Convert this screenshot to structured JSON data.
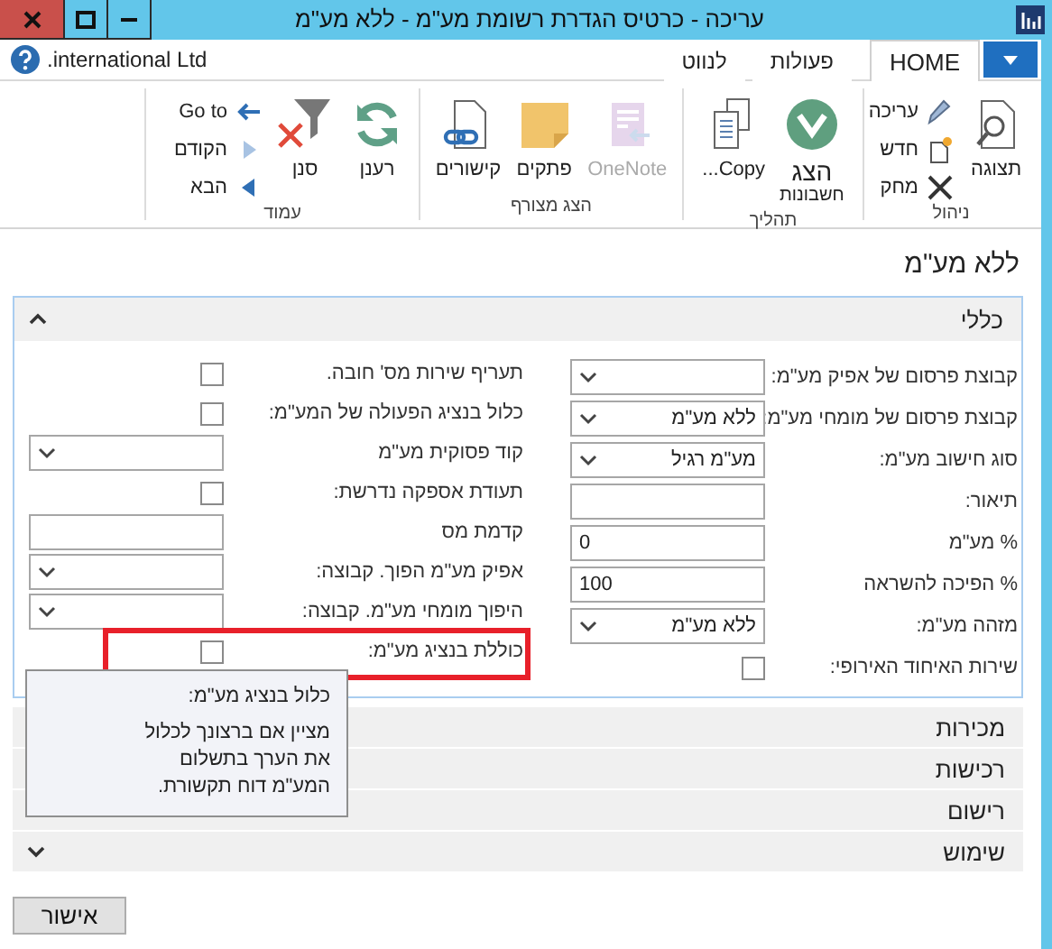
{
  "window": {
    "title": "עריכה - כרטיס הגדרת רשומת מע\"מ - ללא מע\"מ"
  },
  "tabs": [
    {
      "label": "HOME",
      "selected": true
    },
    {
      "label": "פעולות",
      "selected": false
    },
    {
      "label": "לנווט",
      "selected": false
    }
  ],
  "company": ".international Ltd",
  "ribbon": [
    {
      "label": "ניהול",
      "buttons": [
        {
          "kind": "large",
          "label": "תצוגה",
          "disabled": false
        },
        {
          "kind": "small",
          "label": "עריכה",
          "disabled": false
        },
        {
          "kind": "small",
          "label": "חדש",
          "disabled": false
        },
        {
          "kind": "small",
          "label": "מחק",
          "disabled": false
        }
      ]
    },
    {
      "label": "תהליך",
      "buttons": [
        {
          "kind": "large",
          "label": "הצג",
          "sublabel": "חשבונות",
          "disabled": false
        },
        {
          "kind": "large",
          "label": "Copy...",
          "disabled": false
        }
      ]
    },
    {
      "label": "הצג מצורף",
      "buttons": [
        {
          "kind": "large",
          "label": "OneNote",
          "disabled": true
        },
        {
          "kind": "large",
          "label": "פתקים",
          "disabled": false
        },
        {
          "kind": "large",
          "label": "קישורים",
          "disabled": false
        }
      ]
    },
    {
      "label": "עמוד",
      "buttons": [
        {
          "kind": "large",
          "label": "רענן",
          "disabled": false
        },
        {
          "kind": "large",
          "label": "סנן",
          "disabled": false
        },
        {
          "kind": "small",
          "label": "Go to",
          "disabled": false
        },
        {
          "kind": "small",
          "label": "הקודם",
          "disabled": false
        },
        {
          "kind": "small",
          "label": "הבא",
          "disabled": false
        }
      ]
    }
  ],
  "page": {
    "title": "ללא מע\"מ",
    "sections": [
      {
        "title": "כללי",
        "expanded": true,
        "right_fields": [
          {
            "kind": "dropdown",
            "label": "קבוצת פרסום של אפיק מע\"מ:"
          },
          {
            "kind": "dropdown",
            "label": "קבוצת פרסום של מומחי מע\"מ:",
            "value": "ללא מע\"מ"
          },
          {
            "kind": "dropdown",
            "label": "סוג חישוב מע\"מ:",
            "value": "מע\"מ רגיל"
          },
          {
            "kind": "text",
            "label": "תיאור:"
          },
          {
            "kind": "text",
            "label": "% מע\"מ",
            "value": "0"
          },
          {
            "kind": "text",
            "label": "% הפיכה להשראה",
            "value": "100"
          },
          {
            "kind": "dropdown",
            "label": "מזהה מע\"מ:",
            "value": "ללא מע\"מ"
          },
          {
            "kind": "checkbox",
            "label": "שירות האיחוד האירופי:",
            "checked": false
          }
        ],
        "left_fields": [
          {
            "kind": "checkbox",
            "label": "תעריף שירות מס' חובה.",
            "checked": false
          },
          {
            "kind": "checkbox",
            "label": "כלול בנציג הפעולה של המע\"מ:",
            "checked": false
          },
          {
            "kind": "dropdown",
            "label": "קוד פסוקית מע\"מ"
          },
          {
            "kind": "checkbox",
            "label": "תעודת אספקה נדרשת:",
            "checked": false
          },
          {
            "kind": "text",
            "label": "קדמת מס"
          },
          {
            "kind": "dropdown",
            "label": "אפיק מע\"מ הפוך. קבוצה:"
          },
          {
            "kind": "dropdown",
            "label": "היפוך מומחי מע\"מ. קבוצה:"
          },
          {
            "kind": "checkbox",
            "label": "כוללת בנציג מע\"מ:",
            "checked": false,
            "highlighted": true
          }
        ]
      },
      {
        "title": "מכירות",
        "expanded": false
      },
      {
        "title": "רכישות",
        "expanded": false
      },
      {
        "title": "רישום",
        "expanded": false
      },
      {
        "title": "שימוש",
        "expanded": false
      }
    ],
    "tooltip": {
      "title": "כלול בנציג מע\"מ:",
      "body": "מציין אם ברצונך לכלול את הערך בתשלום המע\"מ דוח תקשורת."
    },
    "ok_button": "אישור"
  }
}
